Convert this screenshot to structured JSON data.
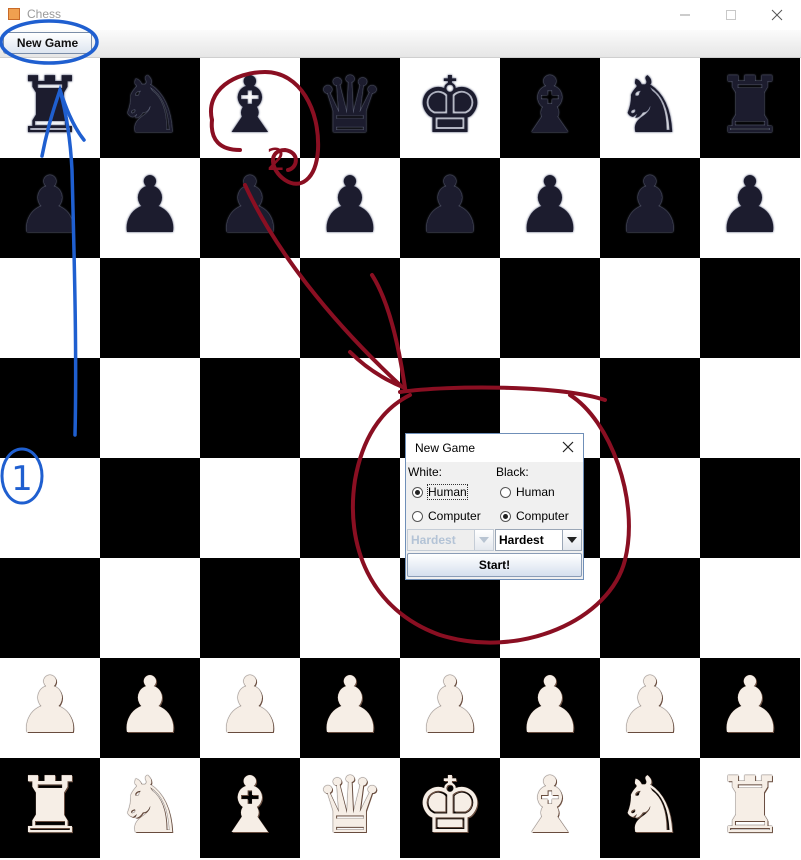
{
  "window": {
    "title": "Chess"
  },
  "toolbar": {
    "new_game_label": "New Game"
  },
  "board": {
    "rows": [
      [
        {
          "glyph": "♜",
          "color": "black",
          "name": "black-rook"
        },
        {
          "glyph": "♞",
          "color": "black",
          "name": "black-knight"
        },
        {
          "glyph": "♝",
          "color": "black",
          "name": "black-bishop"
        },
        {
          "glyph": "♛",
          "color": "black",
          "name": "black-queen"
        },
        {
          "glyph": "♚",
          "color": "black",
          "name": "black-king"
        },
        {
          "glyph": "♝",
          "color": "black",
          "name": "black-bishop"
        },
        {
          "glyph": "♞",
          "color": "black",
          "name": "black-knight"
        },
        {
          "glyph": "♜",
          "color": "black",
          "name": "black-rook"
        }
      ],
      [
        {
          "glyph": "♟",
          "color": "black",
          "name": "black-pawn"
        },
        {
          "glyph": "♟",
          "color": "black",
          "name": "black-pawn"
        },
        {
          "glyph": "♟",
          "color": "black",
          "name": "black-pawn"
        },
        {
          "glyph": "♟",
          "color": "black",
          "name": "black-pawn"
        },
        {
          "glyph": "♟",
          "color": "black",
          "name": "black-pawn"
        },
        {
          "glyph": "♟",
          "color": "black",
          "name": "black-pawn"
        },
        {
          "glyph": "♟",
          "color": "black",
          "name": "black-pawn"
        },
        {
          "glyph": "♟",
          "color": "black",
          "name": "black-pawn"
        }
      ],
      [
        null,
        null,
        null,
        null,
        null,
        null,
        null,
        null
      ],
      [
        null,
        null,
        null,
        null,
        null,
        null,
        null,
        null
      ],
      [
        null,
        null,
        null,
        null,
        null,
        null,
        null,
        null
      ],
      [
        null,
        null,
        null,
        null,
        null,
        null,
        null,
        null
      ],
      [
        {
          "glyph": "♟",
          "color": "white",
          "name": "white-pawn"
        },
        {
          "glyph": "♟",
          "color": "white",
          "name": "white-pawn"
        },
        {
          "glyph": "♟",
          "color": "white",
          "name": "white-pawn"
        },
        {
          "glyph": "♟",
          "color": "white",
          "name": "white-pawn"
        },
        {
          "glyph": "♟",
          "color": "white",
          "name": "white-pawn"
        },
        {
          "glyph": "♟",
          "color": "white",
          "name": "white-pawn"
        },
        {
          "glyph": "♟",
          "color": "white",
          "name": "white-pawn"
        },
        {
          "glyph": "♟",
          "color": "white",
          "name": "white-pawn"
        }
      ],
      [
        {
          "glyph": "♜",
          "color": "white",
          "name": "white-rook"
        },
        {
          "glyph": "♞",
          "color": "white",
          "name": "white-knight"
        },
        {
          "glyph": "♝",
          "color": "white",
          "name": "white-bishop"
        },
        {
          "glyph": "♛",
          "color": "white",
          "name": "white-queen"
        },
        {
          "glyph": "♚",
          "color": "white",
          "name": "white-king"
        },
        {
          "glyph": "♝",
          "color": "white",
          "name": "white-bishop"
        },
        {
          "glyph": "♞",
          "color": "white",
          "name": "white-knight"
        },
        {
          "glyph": "♜",
          "color": "white",
          "name": "white-rook"
        }
      ]
    ]
  },
  "dialog": {
    "title": "New Game",
    "white_label": "White:",
    "black_label": "Black:",
    "white_human": "Human",
    "white_computer": "Computer",
    "black_human": "Human",
    "black_computer": "Computer",
    "white_selected": "Human",
    "black_selected": "Computer",
    "white_difficulty": "Hardest",
    "black_difficulty": "Hardest",
    "start_label": "Start!"
  },
  "annotations": {
    "blue_step_label": "1",
    "red_step_label": "2",
    "blue_color": "#1f5fd0",
    "red_color": "#8a0f22"
  },
  "colors": {
    "light_square": "#ffffff",
    "dark_square": "#000000",
    "dialog_border": "#6f8fb8"
  }
}
